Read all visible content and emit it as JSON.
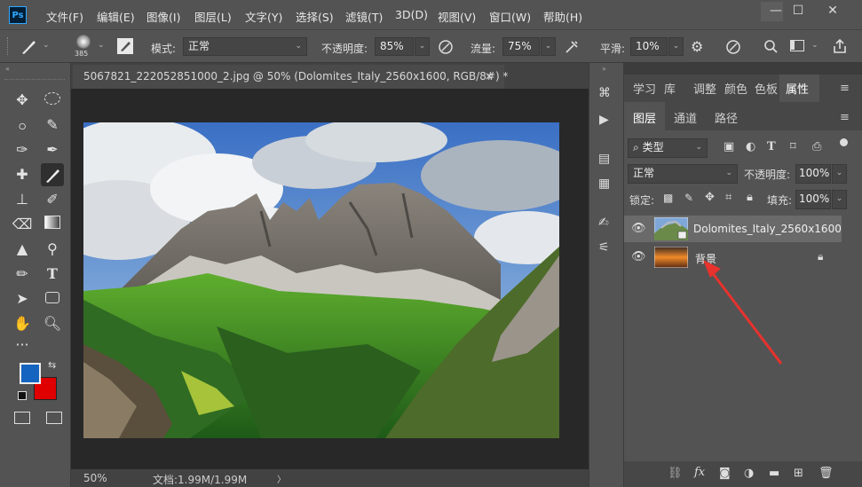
{
  "app": {
    "logo": "Ps"
  },
  "menu": [
    "文件(F)",
    "编辑(E)",
    "图像(I)",
    "图层(L)",
    "文字(Y)",
    "选择(S)",
    "滤镜(T)",
    "3D(D)",
    "视图(V)",
    "窗口(W)",
    "帮助(H)"
  ],
  "window_controls": {
    "minimize": "—",
    "maximize": "☐",
    "close": "✕"
  },
  "options": {
    "brush_size": "385",
    "mode_label": "模式:",
    "mode_value": "正常",
    "opacity_label": "不透明度:",
    "opacity_value": "85%",
    "flow_label": "流量:",
    "flow_value": "75%",
    "smooth_label": "平滑:",
    "smooth_value": "10%"
  },
  "document": {
    "tab_title": "5067821_222052851000_2.jpg @ 50% (Dolomites_Italy_2560x1600, RGB/8#) *",
    "tab_close": "×"
  },
  "status": {
    "zoom": "50%",
    "doc_info": "文档:1.99M/1.99M",
    "arrow": "〉"
  },
  "panel_tabs_top": [
    "学习",
    "库",
    "调整",
    "颜色",
    "色板",
    "属性"
  ],
  "panel_tabs_layers": [
    "图层",
    "通道",
    "路径"
  ],
  "layers_panel": {
    "filter_label": "类型",
    "blend_mode": "正常",
    "opacity_label": "不透明度:",
    "opacity_value": "100%",
    "lock_label": "锁定:",
    "fill_label": "填充:",
    "fill_value": "100%"
  },
  "layers": [
    {
      "name": "Dolomites_Italy_2560x1600",
      "selected": true
    },
    {
      "name": "背景",
      "locked": true
    }
  ],
  "colors": {
    "foreground": "#1565c0",
    "background": "#e00000",
    "annotation_arrow": "#e8322d"
  }
}
